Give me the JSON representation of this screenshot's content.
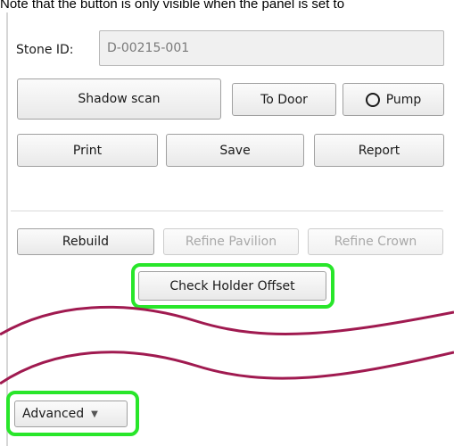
{
  "note_text": "Note that the button is only visible when the panel is set to",
  "stone": {
    "label": "Stone ID:",
    "value": "D-00215-001"
  },
  "buttons": {
    "shadow_scan": "Shadow scan",
    "to_door": "To Door",
    "pump": "Pump",
    "print": "Print",
    "save": "Save",
    "report": "Report",
    "rebuild": "Rebuild",
    "refine_pavilion": "Refine Pavilion",
    "refine_crown": "Refine Crown",
    "check_holder_offset": "Check Holder Offset",
    "advanced": "Advanced"
  },
  "states": {
    "refine_pavilion": "disabled",
    "refine_crown": "disabled"
  },
  "icons": {
    "pump": "circle-icon",
    "advanced": "caret-down-icon"
  },
  "colors": {
    "highlight": "#28e62a",
    "wave": "#a01a50"
  }
}
